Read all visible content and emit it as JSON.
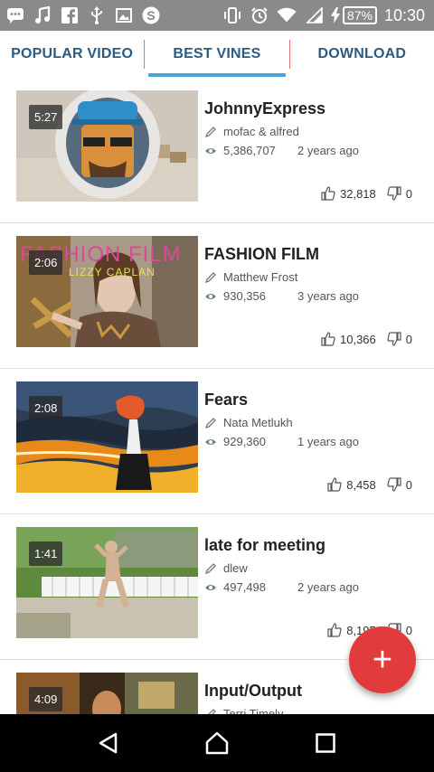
{
  "status_bar": {
    "battery": "87%",
    "time": "10:30",
    "icons": [
      "chat-icon",
      "music-icon",
      "facebook-icon",
      "usb-icon",
      "image-icon",
      "skype-icon",
      "vibrate-icon",
      "alarm-icon",
      "wifi-icon",
      "signal-icon",
      "charging-icon",
      "battery-icon"
    ]
  },
  "tabs": [
    {
      "label": "POPULAR VIDEO",
      "active": false
    },
    {
      "label": "BEST VINES",
      "active": true
    },
    {
      "label": "DOWNLOAD",
      "active": false
    }
  ],
  "videos": [
    {
      "title": "JohnnyExpress",
      "author": "mofac & alfred",
      "views": "5,386,707",
      "age": "2 years ago",
      "duration": "5:27",
      "likes": "32,818",
      "dislikes": "0"
    },
    {
      "title": "FASHION FILM",
      "author": "Matthew Frost",
      "views": "930,356",
      "age": "3 years ago",
      "duration": "2:06",
      "likes": "10,366",
      "dislikes": "0",
      "thumb_text": "FASHION FILM",
      "thumb_subtext": "LIZZY CAPLAN"
    },
    {
      "title": "Fears",
      "author": "Nata Metlukh",
      "views": "929,360",
      "age": "1 years ago",
      "duration": "2:08",
      "likes": "8,458",
      "dislikes": "0"
    },
    {
      "title": "late for meeting",
      "author": "dlew",
      "views": "497,498",
      "age": "2 years ago",
      "duration": "1:41",
      "likes": "8,195",
      "dislikes": "0"
    },
    {
      "title": "Input/Output",
      "author": "Terri Timely",
      "views": "",
      "age": "",
      "duration": "4:09",
      "likes": "",
      "dislikes": ""
    }
  ],
  "fab": {
    "label": "+",
    "icon": "add-icon"
  },
  "navbar": {
    "icons": [
      "back-icon",
      "home-icon",
      "recents-icon"
    ]
  },
  "colors": {
    "status_bar": "#8a8a8a",
    "tab_text": "#2d5a80",
    "tab_indicator": "#4aa5d4",
    "tab_divider": "#e57373",
    "fab": "#e23b3b"
  }
}
